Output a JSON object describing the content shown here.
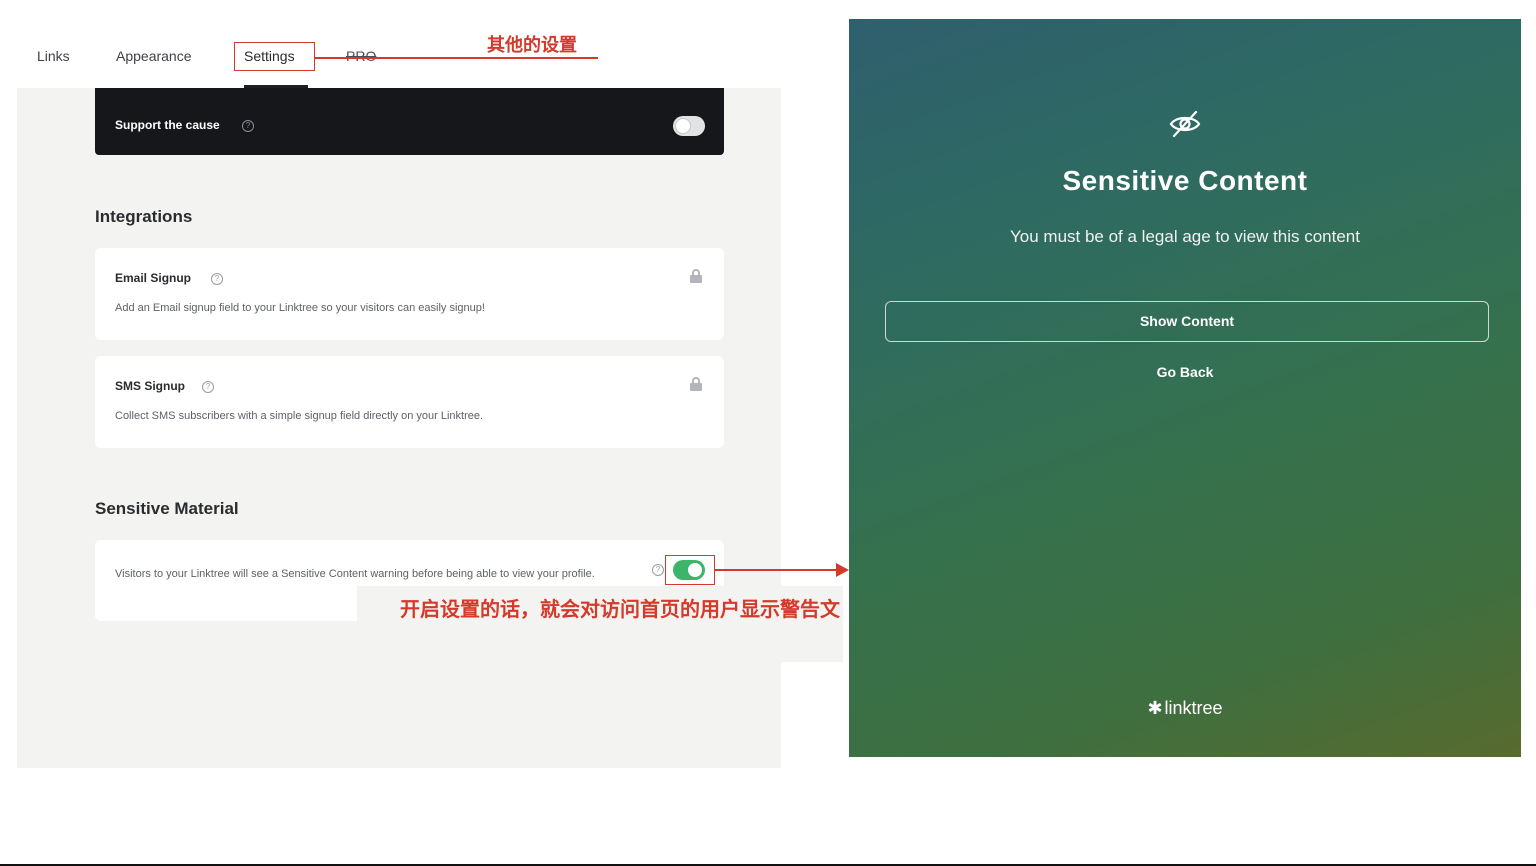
{
  "tabs": {
    "links": "Links",
    "appearance": "Appearance",
    "settings": "Settings",
    "pro": "PRO"
  },
  "support": {
    "label": "Support the cause",
    "help": "?"
  },
  "integrations": {
    "title": "Integrations",
    "email": {
      "title": "Email Signup",
      "description": "Add an Email signup field to your Linktree so your visitors can easily signup!"
    },
    "sms": {
      "title": "SMS Signup",
      "description": "Collect SMS subscribers with a simple signup field directly on your Linktree."
    }
  },
  "sensitive": {
    "title": "Sensitive Material",
    "description": "Visitors to your Linktree will see a Sensitive Content warning before being able to view your profile.",
    "toggle_on": true
  },
  "annotations": {
    "top": "其他的设置",
    "bottom": "开启设置的话，就会对访问首页的用户显示警告文"
  },
  "preview": {
    "title": "Sensitive Content",
    "subtitle": "You must be of a legal age to view this content",
    "show_button": "Show Content",
    "go_back": "Go Back",
    "brand": "linktree",
    "brand_icon": "✱"
  },
  "colors": {
    "accent_red": "#d43a2a",
    "toggle_green": "#3cb56a",
    "dark_card": "#16171b"
  }
}
